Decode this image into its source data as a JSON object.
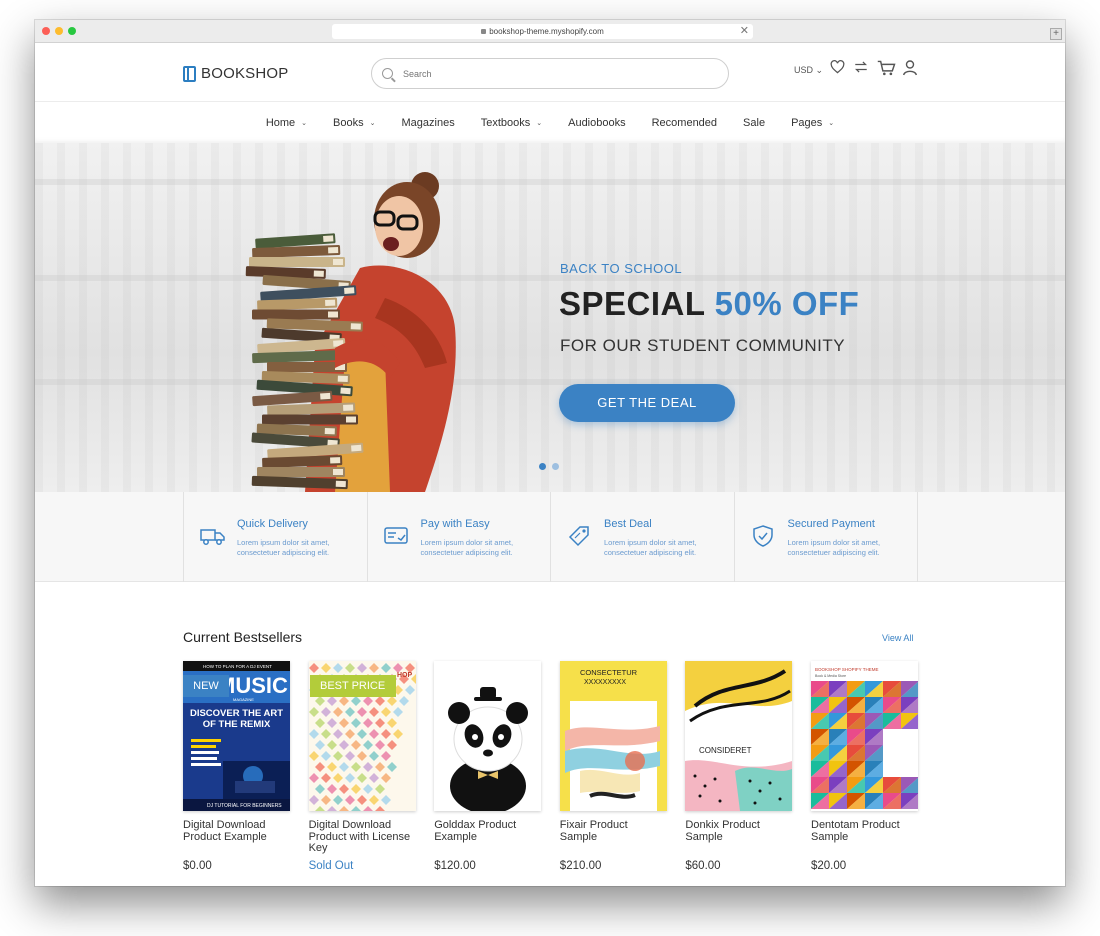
{
  "browser": {
    "url": "bookshop-theme.myshopify.com"
  },
  "header": {
    "logo_text": "BOOKSHOP",
    "search_placeholder": "Search",
    "currency": "USD"
  },
  "nav": {
    "items": [
      {
        "label": "Home",
        "has_dropdown": true
      },
      {
        "label": "Books",
        "has_dropdown": true
      },
      {
        "label": "Magazines",
        "has_dropdown": false
      },
      {
        "label": "Textbooks",
        "has_dropdown": true
      },
      {
        "label": "Audiobooks",
        "has_dropdown": false
      },
      {
        "label": "Recomended",
        "has_dropdown": false
      },
      {
        "label": "Sale",
        "has_dropdown": false
      },
      {
        "label": "Pages",
        "has_dropdown": true
      }
    ]
  },
  "hero": {
    "kicker": "BACK TO SCHOOL",
    "title_main": "SPECIAL",
    "title_accent": "50% OFF",
    "subtitle": "FOR OUR STUDENT COMMUNITY",
    "button": "GET THE DEAL",
    "slides": 2,
    "active_slide": 1
  },
  "features": [
    {
      "title": "Quick Delivery",
      "desc": "Lorem ipsum dolor sit amet, consectetuer adipiscing elit.",
      "icon": "truck-icon"
    },
    {
      "title": "Pay with Easy",
      "desc": "Lorem ipsum dolor sit amet, consectetuer adipiscing elit.",
      "icon": "card-icon"
    },
    {
      "title": "Best Deal",
      "desc": "Lorem ipsum dolor sit amet, consectetuer adipiscing elit.",
      "icon": "tag-icon"
    },
    {
      "title": "Secured Payment",
      "desc": "Lorem ipsum dolor sit amet, consectetuer adipiscing elit.",
      "icon": "shield-icon"
    }
  ],
  "bestsellers": {
    "title": "Current Bestsellers",
    "view_all": "View All",
    "products": [
      {
        "name": "Digital Download Product Example",
        "price": "$0.00",
        "badge": "NEW"
      },
      {
        "name": "Digital Download Product with License Key",
        "price": "Sold Out",
        "badge": "BEST PRICE"
      },
      {
        "name": "Golddax Product Example",
        "price": "$120.00",
        "badge": ""
      },
      {
        "name": "Fixair Product Sample",
        "price": "$210.00",
        "badge": ""
      },
      {
        "name": "Donkix Product Sample",
        "price": "$60.00",
        "badge": ""
      },
      {
        "name": "Dentotam Product Sample",
        "price": "$20.00",
        "badge": ""
      }
    ]
  },
  "covers": {
    "music": {
      "top_line": "HOW TO PLAN FOR A DJ EVENT",
      "title": "MUSIC",
      "subtitle": "MAGAZINE",
      "headline": "DISCOVER THE ART OF THE REMIX",
      "footer": "DJ TUTORIAL FOR BEGINNERS"
    },
    "license": {
      "corner": "HOP"
    },
    "fixair": {
      "title": "CONSECTETUR",
      "subtitle": "XXXXXXXXX"
    },
    "donkix": {
      "title": "CONSIDERET"
    },
    "dentotam": {
      "title": "BOOKSHOP SHOPIFY THEME",
      "subtitle": "Book & Media Store"
    }
  },
  "colors": {
    "accent": "#3b82c4",
    "badge_new": "#3b82c4",
    "badge_best_price": "#b3cc3a"
  }
}
